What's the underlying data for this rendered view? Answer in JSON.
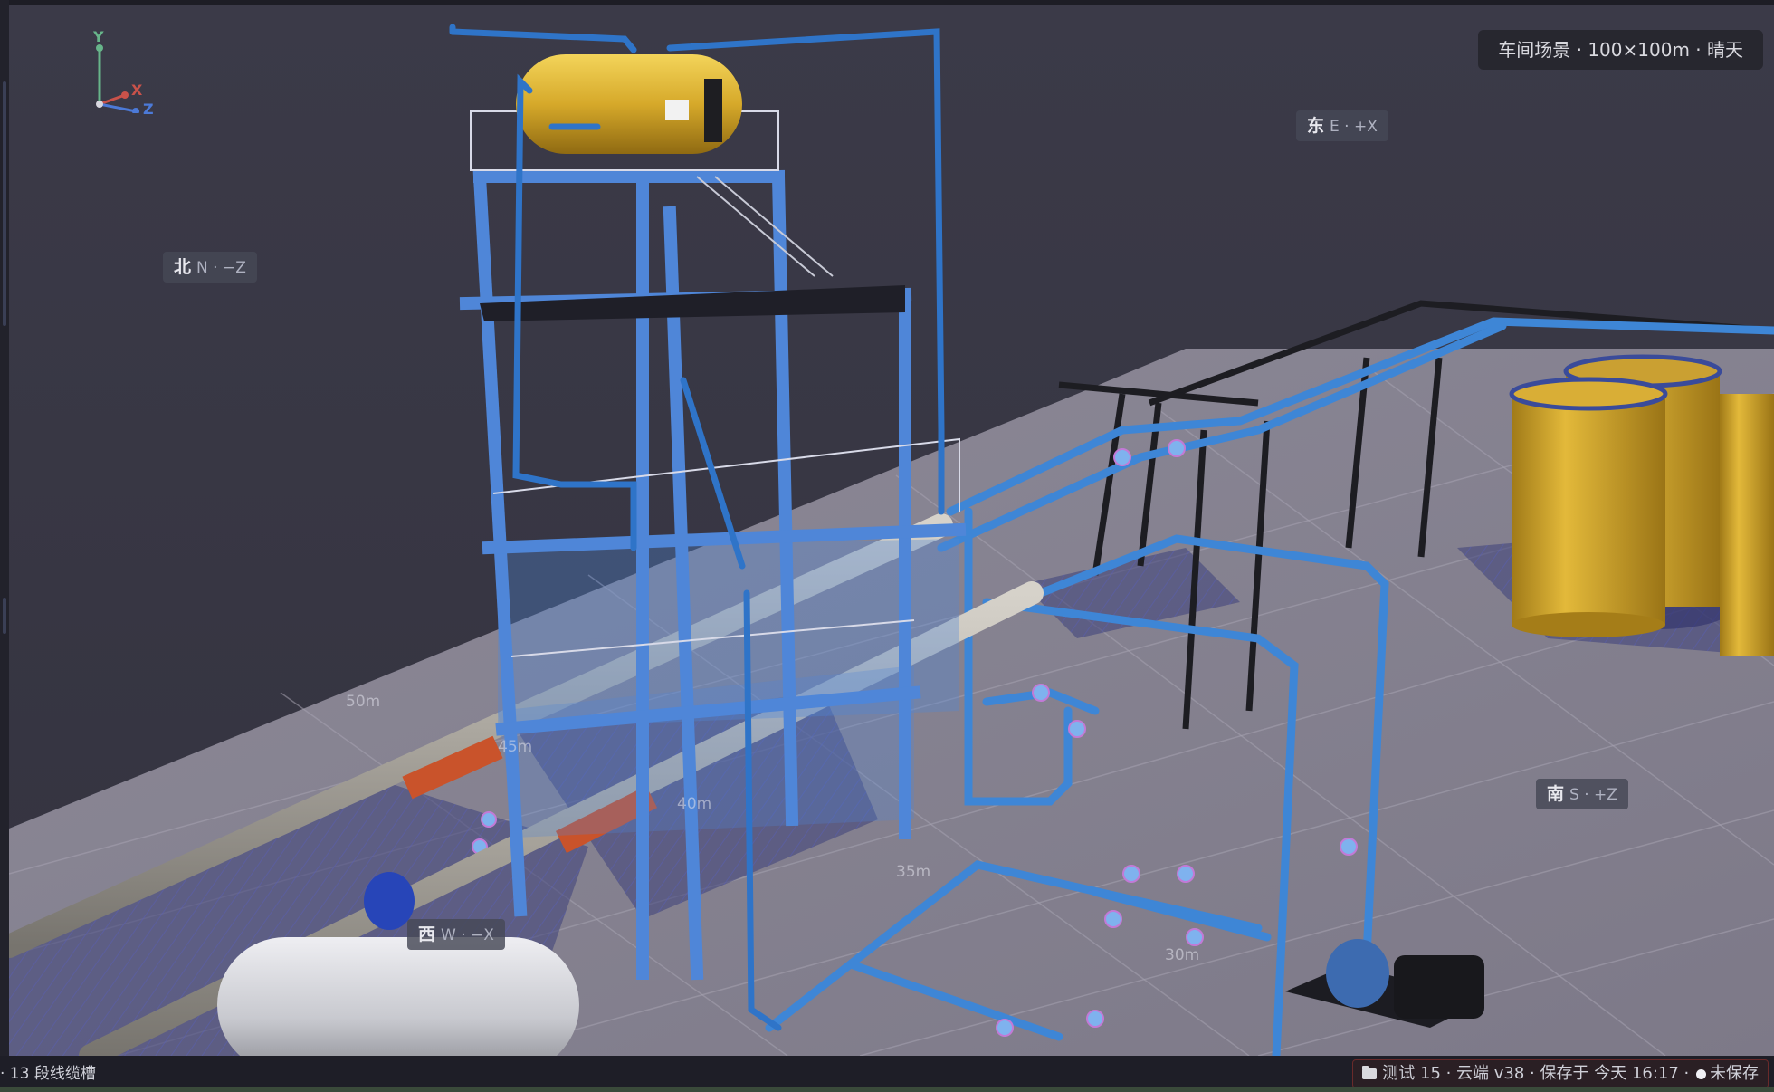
{
  "hud": {
    "scene_title": "车间场景 · 100×100m · 晴天"
  },
  "compass": {
    "north": {
      "cn": "北",
      "rest": "N · −Z"
    },
    "east": {
      "cn": "东",
      "rest": "E · +X"
    },
    "south": {
      "cn": "南",
      "rest": "S · +Z"
    },
    "west": {
      "cn": "西",
      "rest": "W · −X"
    }
  },
  "axes": {
    "x": "X",
    "y": "Y",
    "z": "Z"
  },
  "distance_markers": [
    "50m",
    "45m",
    "40m",
    "35m",
    "30m"
  ],
  "statusbar": {
    "left_text": "· 13 段线缆槽",
    "project_text": "测试 15 · 云端 v38 · 保存于 今天 16:17 ·",
    "save_state": "未保存"
  },
  "colors": {
    "background": "#3a3a46",
    "floor": "#8c8996",
    "steel_structure": "#4f86d8",
    "pipe_blue": "#3f86d4",
    "tank_yellow": "#d6a92a",
    "insulated_pipe": "#b5b1aa",
    "insulation_band": "#c9532b"
  }
}
